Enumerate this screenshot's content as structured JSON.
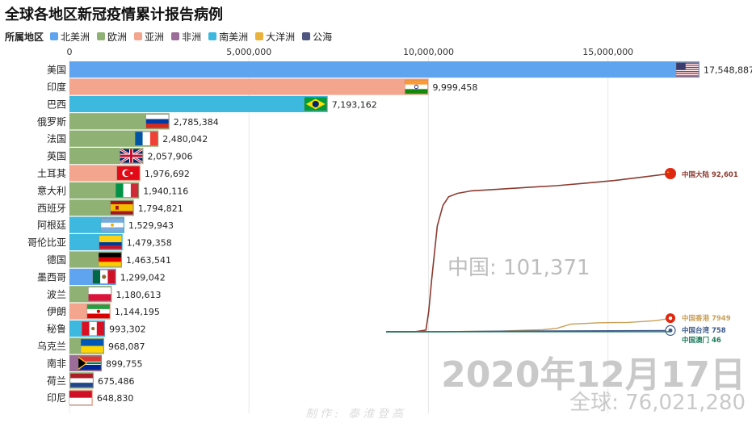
{
  "title": "全球各地区新冠疫情累计报告病例",
  "legend": {
    "title": "所属地区",
    "items": [
      {
        "name": "北美洲",
        "color": "#5ea4ee"
      },
      {
        "name": "欧洲",
        "color": "#8fb174"
      },
      {
        "name": "亚洲",
        "color": "#f4a58e"
      },
      {
        "name": "非洲",
        "color": "#9b6d98"
      },
      {
        "name": "南美洲",
        "color": "#3db9df"
      },
      {
        "name": "大洋洲",
        "color": "#e9b23a"
      },
      {
        "name": "公海",
        "color": "#4f5780"
      }
    ]
  },
  "date_text": "2020年12月17日",
  "total_text": "全球: 76,021,280",
  "credit_text": "制作: 泰淮登高",
  "chart_data": [
    {
      "type": "bar",
      "orientation": "horizontal",
      "xlim": [
        0,
        17548887
      ],
      "xticks": [
        0,
        5000000,
        10000000,
        15000000
      ],
      "xtick_labels": [
        "0",
        "5,000,000",
        "10,000,000",
        "15,000,000"
      ],
      "categories": [
        "美国",
        "印度",
        "巴西",
        "俄罗斯",
        "法国",
        "英国",
        "土耳其",
        "意大利",
        "西班牙",
        "阿根廷",
        "哥伦比亚",
        "德国",
        "墨西哥",
        "波兰",
        "伊朗",
        "秘鲁",
        "乌克兰",
        "南非",
        "荷兰",
        "印尼"
      ],
      "values": [
        17548887,
        9999458,
        7193162,
        2785384,
        2480042,
        2057906,
        1976692,
        1940116,
        1794821,
        1529943,
        1479358,
        1463541,
        1299042,
        1180613,
        1144195,
        993302,
        968087,
        899755,
        675486,
        648830
      ],
      "value_labels": [
        "17,548,887",
        "9,999,458",
        "7,193,162",
        "2,785,384",
        "2,480,042",
        "2,057,906",
        "1,976,692",
        "1,940,116",
        "1,794,821",
        "1,529,943",
        "1,479,358",
        "1,463,541",
        "1,299,042",
        "1,180,613",
        "1,144,195",
        "993,302",
        "968,087",
        "899,755",
        "675,486",
        "648,830"
      ],
      "regions": [
        "北美洲",
        "亚洲",
        "南美洲",
        "欧洲",
        "欧洲",
        "欧洲",
        "亚洲",
        "欧洲",
        "欧洲",
        "南美洲",
        "南美洲",
        "欧洲",
        "北美洲",
        "欧洲",
        "亚洲",
        "南美洲",
        "欧洲",
        "非洲",
        "欧洲",
        "亚洲"
      ],
      "bar_colors": [
        "#5ea4ee",
        "#f4a58e",
        "#3db9df",
        "#8fb174",
        "#8fb174",
        "#8fb174",
        "#f4a58e",
        "#8fb174",
        "#8fb174",
        "#3db9df",
        "#3db9df",
        "#8fb174",
        "#5ea4ee",
        "#8fb174",
        "#f4a58e",
        "#3db9df",
        "#8fb174",
        "#9b6d98",
        "#8fb174",
        "#f4a58e"
      ],
      "flag_icons": [
        "us-flag-icon",
        "india-flag-icon",
        "brazil-flag-icon",
        "russia-flag-icon",
        "france-flag-icon",
        "uk-flag-icon",
        "turkey-flag-icon",
        "italy-flag-icon",
        "spain-flag-icon",
        "argentina-flag-icon",
        "colombia-flag-icon",
        "germany-flag-icon",
        "mexico-flag-icon",
        "poland-flag-icon",
        "iran-flag-icon",
        "peru-flag-icon",
        "ukraine-flag-icon",
        "south-africa-flag-icon",
        "netherlands-flag-icon",
        "indonesia-flag-icon"
      ]
    },
    {
      "type": "line",
      "annotation": "中国: 101,371",
      "x_range": [
        0,
        100
      ],
      "y_range": [
        0,
        92601
      ],
      "series": [
        {
          "name": "中国大陆",
          "end_value": 92601,
          "end_label": "中国大陆 92,601",
          "color": "#8b3a2f",
          "marker_icon": "china-flag-icon",
          "x": [
            0,
            10,
            14,
            15,
            16,
            18,
            20,
            22,
            25,
            30,
            40,
            50,
            60,
            70,
            80,
            90,
            100
          ],
          "y": [
            0,
            0,
            1000,
            12000,
            30000,
            62000,
            74000,
            79000,
            81000,
            82500,
            83500,
            84500,
            85500,
            87000,
            88500,
            90500,
            92601
          ]
        },
        {
          "name": "中国香港",
          "end_value": 7949,
          "end_label": "中国香港 7949",
          "color": "#c9a15a",
          "marker_icon": "hong-kong-flag-icon",
          "x": [
            0,
            20,
            40,
            50,
            55,
            60,
            65,
            75,
            85,
            95,
            100
          ],
          "y": [
            0,
            100,
            400,
            1000,
            1200,
            2000,
            4500,
            5300,
            5500,
            6500,
            7949
          ]
        },
        {
          "name": "中国台湾",
          "end_value": 758,
          "end_label": "中国台湾 758",
          "color": "#3d5a8a",
          "marker_icon": "taiwan-flag-icon",
          "x": [
            0,
            20,
            40,
            60,
            80,
            100
          ],
          "y": [
            0,
            50,
            400,
            480,
            600,
            758
          ]
        },
        {
          "name": "中国澳门",
          "end_value": 46,
          "end_label": "中国澳门 46",
          "color": "#1a7a5a",
          "marker_icon": "",
          "x": [
            0,
            20,
            40,
            60,
            80,
            100
          ],
          "y": [
            0,
            10,
            40,
            45,
            46,
            46
          ]
        }
      ]
    }
  ]
}
